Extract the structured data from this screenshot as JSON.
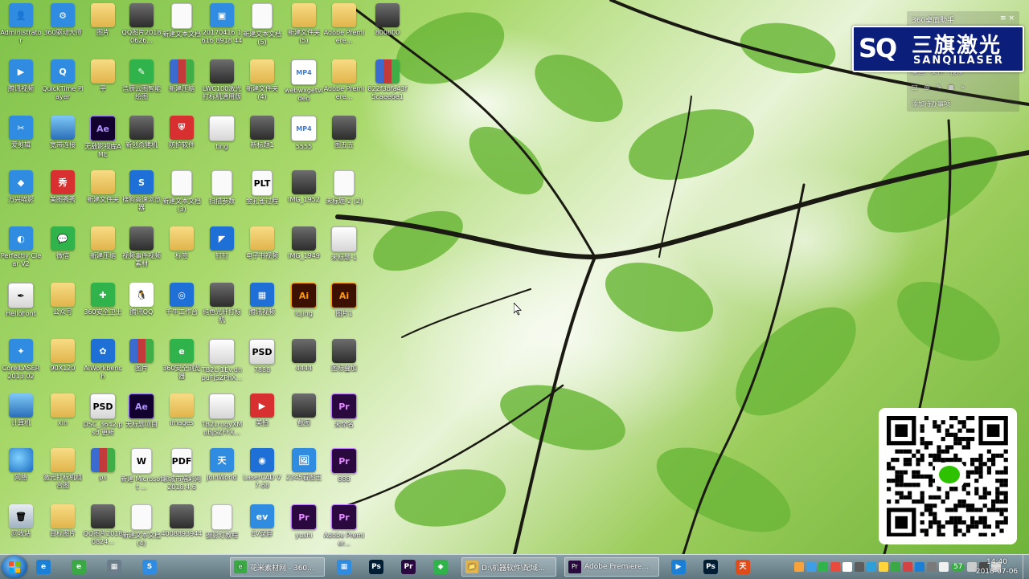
{
  "desktop": {
    "icons": [
      {
        "label": "Administrator",
        "type": "user",
        "glyph": "👤"
      },
      {
        "label": "360驱动大师",
        "type": "app",
        "glyph": "⚙"
      },
      {
        "label": "图片",
        "type": "folder",
        "glyph": ""
      },
      {
        "label": "QQ图片20180626...",
        "type": "photo",
        "glyph": ""
      },
      {
        "label": "新建文本文档",
        "type": "doc",
        "glyph": ""
      },
      {
        "label": "20170416 1616 8918 4494D",
        "type": "app",
        "glyph": "▣"
      },
      {
        "label": "新建文本文档 (5)",
        "type": "doc",
        "glyph": ""
      },
      {
        "label": "新建文件夹 (5)",
        "type": "folder",
        "glyph": ""
      },
      {
        "label": "Adobe Premiere...",
        "type": "folder",
        "glyph": ""
      },
      {
        "label": "800800",
        "type": "photo",
        "glyph": ""
      },
      {
        "label": "腾讯视频",
        "type": "app",
        "glyph": "▶"
      },
      {
        "label": "QuickTime Player",
        "type": "app",
        "glyph": "Q"
      },
      {
        "label": "平",
        "type": "folder",
        "glyph": ""
      },
      {
        "label": "浩辰云图智能绘图",
        "type": "green",
        "glyph": "✎"
      },
      {
        "label": "新建压缩",
        "type": "zip",
        "glyph": ""
      },
      {
        "label": "LWC100激光打标机通用版",
        "type": "photo",
        "glyph": ""
      },
      {
        "label": "新建文件夹 (4)",
        "type": "folder",
        "glyph": ""
      },
      {
        "label": "webwxgetvideo",
        "type": "mp4",
        "glyph": "MP4"
      },
      {
        "label": "Adobe Premiere...",
        "type": "folder",
        "glyph": ""
      },
      {
        "label": "822f3bfa43f5caee6e13...",
        "type": "zip",
        "glyph": ""
      },
      {
        "label": "爱剪辑",
        "type": "app",
        "glyph": "✂"
      },
      {
        "label": "宽带连接",
        "type": "pc",
        "glyph": ""
      },
      {
        "label": "无敌影视库AME",
        "type": "ae",
        "glyph": "Ae"
      },
      {
        "label": "新创杀猪机",
        "type": "photo",
        "glyph": ""
      },
      {
        "label": "防护软件",
        "type": "red",
        "glyph": "⛨"
      },
      {
        "label": "ting",
        "type": "img",
        "glyph": ""
      },
      {
        "label": "新标题1",
        "type": "photo",
        "glyph": ""
      },
      {
        "label": "5555",
        "type": "mp4",
        "glyph": "MP4"
      },
      {
        "label": "图五五",
        "type": "photo",
        "glyph": ""
      },
      {
        "label": "万兴喵影",
        "type": "app",
        "glyph": "◆"
      },
      {
        "label": "美图秀秀",
        "type": "red",
        "glyph": "秀"
      },
      {
        "label": "新建文件夹",
        "type": "folder",
        "glyph": ""
      },
      {
        "label": "搜狗高速浏览器",
        "type": "blue",
        "glyph": "S"
      },
      {
        "label": "新建文本文档 (3)",
        "type": "doc",
        "glyph": ""
      },
      {
        "label": "扫描参数",
        "type": "doc",
        "glyph": ""
      },
      {
        "label": "金孔雀过程",
        "type": "doc",
        "glyph": "PLT"
      },
      {
        "label": "IMG_1952",
        "type": "photo",
        "glyph": ""
      },
      {
        "label": "未标题-2 (2)",
        "type": "doc",
        "glyph": ""
      },
      {
        "label": "Perfectly Clear V2",
        "type": "app",
        "glyph": "◐"
      },
      {
        "label": "微信",
        "type": "green",
        "glyph": "💬"
      },
      {
        "label": "新建压缩",
        "type": "folder",
        "glyph": ""
      },
      {
        "label": "视频事件视频素材",
        "type": "photo",
        "glyph": ""
      },
      {
        "label": "标签",
        "type": "folder",
        "glyph": ""
      },
      {
        "label": "钉钉",
        "type": "blue",
        "glyph": "◤"
      },
      {
        "label": "电子书视频",
        "type": "folder",
        "glyph": ""
      },
      {
        "label": "IMG_1949",
        "type": "photo",
        "glyph": ""
      },
      {
        "label": "未标题-1",
        "type": "img",
        "glyph": ""
      },
      {
        "label": "HelloFont",
        "type": "img",
        "glyph": "✒"
      },
      {
        "label": "公众号",
        "type": "folder",
        "glyph": ""
      },
      {
        "label": "360安全卫士",
        "type": "green",
        "glyph": "✚"
      },
      {
        "label": "腾讯QQ",
        "type": "qq",
        "glyph": "🐧"
      },
      {
        "label": "千牛工作台",
        "type": "blue",
        "glyph": "◎"
      },
      {
        "label": "纯色光纤打标机",
        "type": "photo",
        "glyph": ""
      },
      {
        "label": "腾讯视频",
        "type": "blue",
        "glyph": "▦"
      },
      {
        "label": "lujing",
        "type": "ai",
        "glyph": "Ai"
      },
      {
        "label": "图片1",
        "type": "ai",
        "glyph": "Ai"
      },
      {
        "label": "CorelLASER 2013.02",
        "type": "app",
        "glyph": "✦"
      },
      {
        "label": "90X120",
        "type": "folder",
        "glyph": ""
      },
      {
        "label": "AiWorkbench",
        "type": "blue",
        "glyph": "✿"
      },
      {
        "label": "图片",
        "type": "zip",
        "glyph": ""
      },
      {
        "label": "360安全浏览器",
        "type": "green",
        "glyph": "e"
      },
      {
        "label": "TB2Lr1Ev.dnpuFjSZPhX...",
        "type": "img",
        "glyph": ""
      },
      {
        "label": "7888",
        "type": "img",
        "glyph": "PSD"
      },
      {
        "label": "4444",
        "type": "photo",
        "glyph": ""
      },
      {
        "label": "图标叠加",
        "type": "photo",
        "glyph": ""
      },
      {
        "label": "计算机",
        "type": "pc",
        "glyph": ""
      },
      {
        "label": "xin",
        "type": "folder",
        "glyph": ""
      },
      {
        "label": "DSC_3642.psd 更新",
        "type": "img",
        "glyph": "PSD"
      },
      {
        "label": "无标题项目",
        "type": "ae",
        "glyph": "Ae"
      },
      {
        "label": "images",
        "type": "folder",
        "glyph": ""
      },
      {
        "label": "TB2LruqyXMuBjSZFFX...",
        "type": "img",
        "glyph": ""
      },
      {
        "label": "美拍",
        "type": "red",
        "glyph": "▶"
      },
      {
        "label": "截图",
        "type": "photo",
        "glyph": ""
      },
      {
        "label": "未命名",
        "type": "pr",
        "glyph": "Pr"
      },
      {
        "label": "网络",
        "type": "earth",
        "glyph": ""
      },
      {
        "label": "激光打标机组合图",
        "type": "folder",
        "glyph": ""
      },
      {
        "label": "ps",
        "type": "zip",
        "glyph": ""
      },
      {
        "label": "新建 Microsoft ...",
        "type": "doc",
        "glyph": "W"
      },
      {
        "label": "聊城市福彩网 2018.4.6",
        "type": "doc",
        "glyph": "PDF"
      },
      {
        "label": "JoinWorld",
        "type": "app",
        "glyph": "天"
      },
      {
        "label": "LaserCAD V7.68",
        "type": "blue",
        "glyph": "◉"
      },
      {
        "label": "2345看图王",
        "type": "app",
        "glyph": "🖼"
      },
      {
        "label": "888",
        "type": "pr",
        "glyph": "Pr"
      },
      {
        "label": "回收站",
        "type": "recycle",
        "glyph": "🗑"
      },
      {
        "label": "目标图片",
        "type": "folder",
        "glyph": ""
      },
      {
        "label": "QQ图片20180824...",
        "type": "photo",
        "glyph": ""
      },
      {
        "label": "新建文本文档 (4)",
        "type": "doc",
        "glyph": ""
      },
      {
        "label": "4008893944",
        "type": "photo",
        "glyph": ""
      },
      {
        "label": "摄影灯教程",
        "type": "doc",
        "glyph": ""
      },
      {
        "label": "EV录屏",
        "type": "app",
        "glyph": "ev"
      },
      {
        "label": "yushi",
        "type": "pr",
        "glyph": "Pr"
      },
      {
        "label": "Adobe Premier...",
        "type": "pr",
        "glyph": "Pr"
      }
    ]
  },
  "widget": {
    "title": "360桌面助手",
    "menu": "≡ ×",
    "row1": [
      "桌面",
      "文件",
      "搜索"
    ],
    "row2": [
      "□",
      "◎",
      "✎",
      "▦",
      "»"
    ],
    "row3": "添加待办事项"
  },
  "brand": {
    "mark": "SQ",
    "name_cn": "三旗激光",
    "name_en": "SANQILASER"
  },
  "taskbar": {
    "pinned": [
      {
        "name": "ie",
        "glyph": "e",
        "bg": "#1c7fd6"
      },
      {
        "name": "360-browser",
        "glyph": "e",
        "bg": "#3aa845"
      },
      {
        "name": "calculator",
        "glyph": "▦",
        "bg": "#6b7d8a"
      },
      {
        "name": "sogou",
        "glyph": "S",
        "bg": "#2f8ce0"
      }
    ],
    "windows": [
      {
        "label": "花米素材网 - 360...",
        "glyph": "e",
        "bg": "#3aa845"
      },
      {
        "label": "",
        "glyph": "▦",
        "bg": "#2f8ce0"
      },
      {
        "label": "",
        "glyph": "Ps",
        "bg": "#001d34"
      },
      {
        "label": "",
        "glyph": "Pr",
        "bg": "#2a0a3e"
      },
      {
        "label": "",
        "glyph": "◆",
        "bg": "#2fb34a"
      },
      {
        "label": "D:\\机器软件\\配域...",
        "glyph": "📁",
        "bg": "#e1b44c"
      },
      {
        "label": "Adobe Premiere...",
        "glyph": "Pr",
        "bg": "#2a0a3e"
      },
      {
        "label": "",
        "glyph": "▶",
        "bg": "#1c7fd6"
      },
      {
        "label": "",
        "glyph": "Ps",
        "bg": "#001d34"
      },
      {
        "label": "",
        "glyph": "天",
        "bg": "#e04b1a"
      }
    ],
    "tray_count": "57",
    "time": "14:40",
    "date": "2018-07-06"
  }
}
